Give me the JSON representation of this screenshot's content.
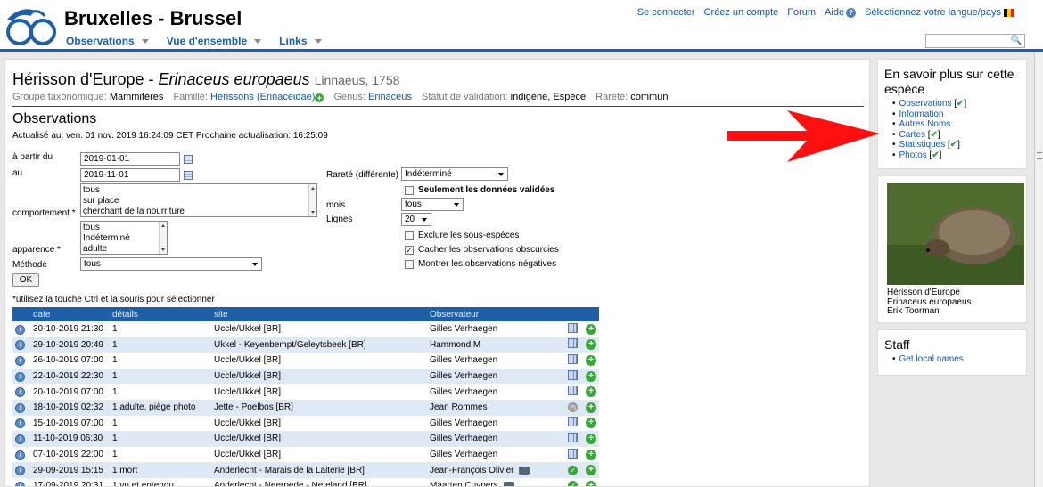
{
  "header": {
    "site_title": "Bruxelles - Brussel",
    "nav": [
      "Observations",
      "Vue d'ensemble",
      "Links"
    ],
    "top_links": {
      "login": "Se connecter",
      "register": "Créez un compte",
      "forum": "Forum",
      "help": "Aide",
      "language": "Sélectionnez votre langue/pays"
    },
    "search_placeholder": ""
  },
  "species": {
    "common_name": "Hérisson d'Europe - ",
    "scientific_name": "Erinaceus europaeus",
    "author": "Linnaeus, 1758",
    "tax": {
      "group_label": "Groupe taxonomique:",
      "group_value": "Mammifères",
      "family_label": "Famille:",
      "family_value": "Hérissons (Erinaceidae)",
      "genus_label": "Genus:",
      "genus_value": "Erinaceus",
      "status_label": "Statut de validation:",
      "status_value": "indigène, Espèce",
      "rarity_label": "Rareté:",
      "rarity_value": "commun"
    }
  },
  "observations": {
    "heading": "Observations",
    "updated": "Actualisé au: ven. 01 nov. 2019 16:24:09 CET Prochaine actualisation: 16:25:09"
  },
  "filters": {
    "from_label": "à partir du",
    "from_value": "2019-01-01",
    "to_label": "au",
    "to_value": "2019-11-01",
    "behaviour_label": "comportement *",
    "behaviour_options": [
      "tous",
      "sur place",
      "cherchant de la nourriture"
    ],
    "appearance_label": "apparence *",
    "appearance_options": [
      "tous",
      "Indéterminé",
      "adulte"
    ],
    "method_label": "Méthode",
    "method_value": "tous",
    "rarity_label": "Rareté (différente)",
    "rarity_value": "Indéterminé",
    "only_validated": "Seulement les données validées",
    "month_label": "mois",
    "month_value": "tous",
    "rows_label": "Lignes",
    "rows_value": "20",
    "exclude_subspecies": "Exclure les sous-espèces",
    "hide_obscured": "Cacher les observations obscurcies",
    "show_negative": "Montrer les observations négatives",
    "ok": "OK",
    "hint": "*utilisez la touche Ctrl et la souris pour sélectionner"
  },
  "table": {
    "headers": [
      "date",
      "détails",
      "site",
      "Observateur"
    ],
    "rows": [
      {
        "date": "30-10-2019 21:30",
        "details": "1",
        "site": "Uccle/Ukkel [BR]",
        "observer": "Gilles Verhaegen",
        "status": "grid"
      },
      {
        "date": "29-10-2019 20:49",
        "details": "1",
        "site": "Ukkel - Keyenbempt/Geleytsbeek [BR]",
        "observer": "Hammond M",
        "status": "grid"
      },
      {
        "date": "26-10-2019 07:00",
        "details": "1",
        "site": "Uccle/Ukkel [BR]",
        "observer": "Gilles Verhaegen",
        "status": "grid"
      },
      {
        "date": "22-10-2019 22:30",
        "details": "1",
        "site": "Uccle/Ukkel [BR]",
        "observer": "Gilles Verhaegen",
        "status": "grid"
      },
      {
        "date": "20-10-2019 07:00",
        "details": "1",
        "site": "Uccle/Ukkel [BR]",
        "observer": "Gilles Verhaegen",
        "status": "grid"
      },
      {
        "date": "18-10-2019 02:32",
        "details": "1 adulte, piège photo",
        "site": "Jette - Poelbos [BR]",
        "observer": "Jean Rommes",
        "status": "clock"
      },
      {
        "date": "15-10-2019 07:00",
        "details": "1",
        "site": "Uccle/Ukkel [BR]",
        "observer": "Gilles Verhaegen",
        "status": "grid"
      },
      {
        "date": "11-10-2019 06:30",
        "details": "1",
        "site": "Uccle/Ukkel [BR]",
        "observer": "Gilles Verhaegen",
        "status": "grid"
      },
      {
        "date": "07-10-2019 22:00",
        "details": "1",
        "site": "Uccle/Ukkel [BR]",
        "observer": "Gilles Verhaegen",
        "status": "grid"
      },
      {
        "date": "29-09-2019 15:15",
        "details": "1 mort",
        "site": "Anderlecht - Marais de la Laiterie [BR]",
        "observer": "Jean-François Olivier",
        "status": "check"
      },
      {
        "date": "17-09-2019 20:31",
        "details": "1 vu et entendu",
        "site": "Anderlecht - Neerpede - Neteland [BR]",
        "observer": "Maarten Cuypers",
        "status": "check"
      }
    ]
  },
  "sidebar": {
    "more_title": "En savoir plus sur cette espèce",
    "more_links": [
      "Observations",
      "Information",
      "Autres Noms",
      "Cartes",
      "Statistiques",
      "Photos"
    ],
    "photo_caption": [
      "Hérisson d'Europe",
      "Erinaceus europaeus",
      "Erik Toorman"
    ],
    "staff_title": "Staff",
    "staff_links": [
      "Get local names"
    ]
  },
  "colors": {
    "brand_blue": "#1f5fa8",
    "row_alt": "#dfe8f5",
    "arrow_red": "#ff1010",
    "ok_green": "#3aa63a"
  }
}
